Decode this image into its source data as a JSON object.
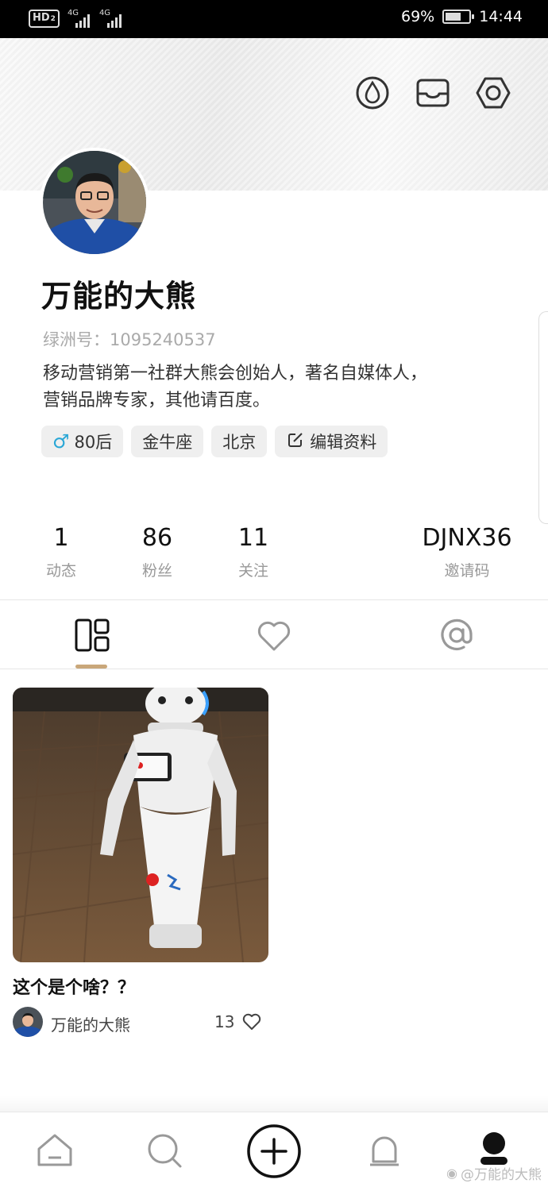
{
  "status_bar": {
    "hd_label": "HD",
    "hd_sub": "2",
    "net1": "4G",
    "net2": "4G",
    "battery_pct": "69%",
    "battery_level": 0.69,
    "time": "14:44"
  },
  "header_icons": [
    "drop-icon",
    "inbox-icon",
    "settings-hex-icon"
  ],
  "profile": {
    "name": "万能的大熊",
    "uid_label": "绿洲号：",
    "uid_value": "1095240537",
    "bio_line1": "移动营销第一社群大熊会创始人，著名自媒体人，",
    "bio_line2": "营销品牌专家，其他请百度。",
    "tags": [
      {
        "icon": "male-icon",
        "glyph": "♂",
        "label": "80后"
      },
      {
        "label": "金牛座"
      },
      {
        "label": "北京"
      },
      {
        "icon": "edit-icon",
        "label": "编辑资料"
      }
    ]
  },
  "stats": [
    {
      "value": "1",
      "label": "动态"
    },
    {
      "value": "86",
      "label": "粉丝"
    },
    {
      "value": "11",
      "label": "关注"
    },
    {
      "value": "DJNX36",
      "label": "邀请码"
    }
  ],
  "tabs": [
    {
      "icon": "grid-icon",
      "active": true
    },
    {
      "icon": "heart-icon",
      "active": false
    },
    {
      "icon": "at-icon",
      "active": false
    }
  ],
  "accent_color": "#c9a77a",
  "post": {
    "title": "这个是个啥？？",
    "author": "万能的大熊",
    "likes": "13"
  },
  "bottom_nav": [
    "home-icon",
    "search-icon",
    "add-icon",
    "bell-icon",
    "profile-icon"
  ],
  "watermark": {
    "weibo": "@万能的大熊"
  }
}
